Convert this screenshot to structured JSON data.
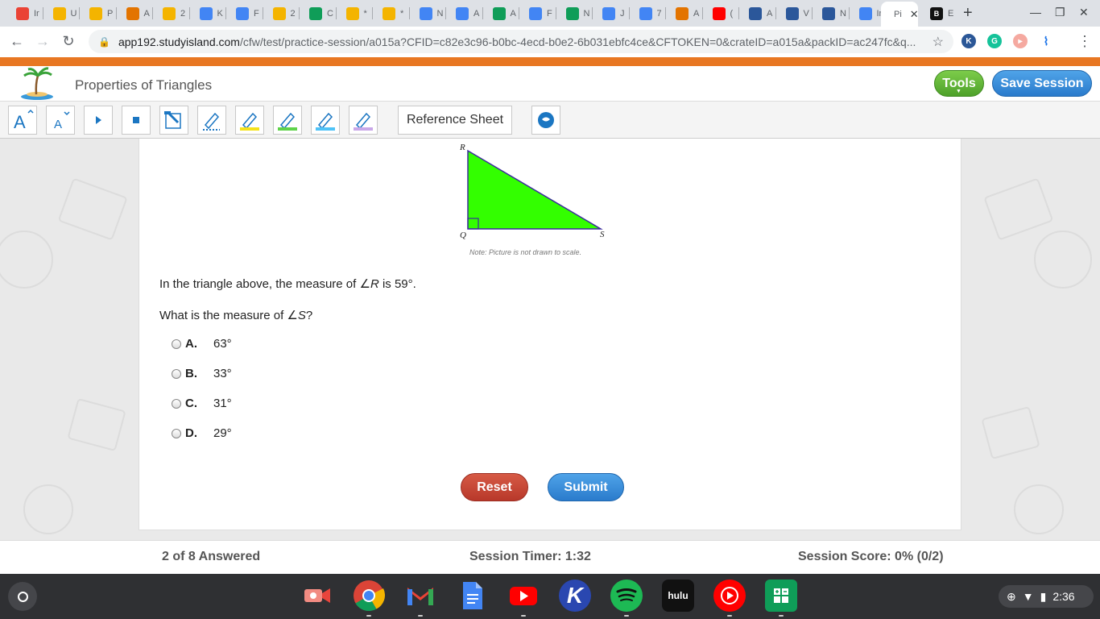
{
  "browser": {
    "tabs": [
      {
        "label": "Ir",
        "icon": "gmail-icon",
        "color": "#ea4335"
      },
      {
        "label": "U",
        "icon": "slides-icon",
        "color": "#f4b400"
      },
      {
        "label": "P",
        "icon": "classkick-icon",
        "color": "#f4b400"
      },
      {
        "label": "A",
        "icon": "classroom-icon",
        "color": "#e37400"
      },
      {
        "label": "2",
        "icon": "slides-icon",
        "color": "#f4b400"
      },
      {
        "label": "K",
        "icon": "docs-icon",
        "color": "#4285f4"
      },
      {
        "label": "F",
        "icon": "google-icon",
        "color": "#4285f4"
      },
      {
        "label": "2",
        "icon": "slides-icon",
        "color": "#f4b400"
      },
      {
        "label": "C",
        "icon": "classroom-icon",
        "color": "#0f9d58"
      },
      {
        "label": "*",
        "icon": "slides-icon",
        "color": "#f4b400"
      },
      {
        "label": "*",
        "icon": "slides-icon",
        "color": "#f4b400"
      },
      {
        "label": "N",
        "icon": "docs-icon",
        "color": "#4285f4"
      },
      {
        "label": "A",
        "icon": "docs-icon",
        "color": "#4285f4"
      },
      {
        "label": "A",
        "icon": "drive-icon",
        "color": "#0f9d58"
      },
      {
        "label": "F",
        "icon": "docs-icon",
        "color": "#4285f4"
      },
      {
        "label": "N",
        "icon": "drive-icon",
        "color": "#0f9d58"
      },
      {
        "label": "J",
        "icon": "docs-icon",
        "color": "#4285f4"
      },
      {
        "label": "7",
        "icon": "google-icon",
        "color": "#4285f4"
      },
      {
        "label": "A",
        "icon": "classroom-icon",
        "color": "#e37400"
      },
      {
        "label": "(",
        "icon": "youtube-icon",
        "color": "#ff0000"
      },
      {
        "label": "A",
        "icon": "music-icon",
        "color": "#2b579a"
      },
      {
        "label": "V",
        "icon": "music-icon",
        "color": "#2b579a"
      },
      {
        "label": "N",
        "icon": "music-icon",
        "color": "#2b579a"
      },
      {
        "label": "Ir",
        "icon": "google-icon",
        "color": "#4285f4"
      }
    ],
    "active_tab": {
      "label": "Pi",
      "close": "✕"
    },
    "next_tab": {
      "label": "E",
      "icon": "b-icon",
      "color": "#111111"
    },
    "url_host": "app192.studyisland.com",
    "url_path": "/cfw/test/practice-session/a015a?CFID=c82e3c96-b0bc-4ecd-b0e2-6b031ebfc4ce&CFTOKEN=0&crateID=a015a&packID=ac247fc&q..."
  },
  "header": {
    "title": "Properties of Triangles",
    "tools_label": "Tools",
    "save_label": "Save Session"
  },
  "toolbar": {
    "reference_sheet_label": "Reference Sheet",
    "tools": [
      "font-increase-icon",
      "font-decrease-icon",
      "play-icon",
      "stop-icon",
      "line-reader-icon",
      "pen-blue-icon",
      "highlighter-yellow-icon",
      "highlighter-green-icon",
      "highlighter-blue-icon",
      "eraser-icon",
      "chat-icon"
    ]
  },
  "question": {
    "figure": {
      "vertices": [
        "R",
        "Q",
        "S"
      ],
      "fill_color": "#33ff00",
      "note": "Note: Picture is not drawn to scale."
    },
    "stem_prefix": "In the triangle above, the measure of ∠",
    "stem_angle": "R",
    "stem_suffix": " is 59°.",
    "prompt_prefix": "What is the measure of ∠",
    "prompt_angle": "S",
    "prompt_suffix": "?",
    "choices": [
      {
        "letter": "A.",
        "value": "63°"
      },
      {
        "letter": "B.",
        "value": "33°"
      },
      {
        "letter": "C.",
        "value": "31°"
      },
      {
        "letter": "D.",
        "value": "29°"
      }
    ],
    "reset_label": "Reset",
    "submit_label": "Submit"
  },
  "status": {
    "answered": "2 of 8 Answered",
    "timer": "Session Timer: 1:32",
    "score": "Session Score: 0% (0/2)"
  },
  "shelf": {
    "apps": [
      "screencast-icon",
      "chrome-icon",
      "gmail-icon",
      "docs-icon",
      "youtube-icon",
      "kahoot-icon",
      "spotify-icon",
      "hulu-icon",
      "youtube-music-icon",
      "sheets-icon"
    ],
    "hulu_label": "hulu",
    "kahoot_label": "K",
    "time": "2:36"
  }
}
